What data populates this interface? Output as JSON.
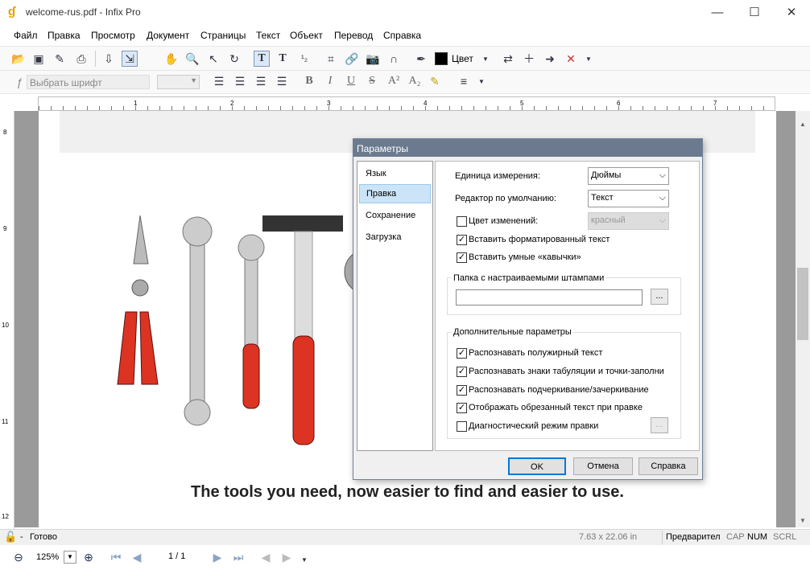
{
  "window": {
    "title": "welcome-rus.pdf - Infix Pro",
    "minimize": "—",
    "maximize": "☐",
    "close": "✕"
  },
  "menu": [
    "Файл",
    "Правка",
    "Просмотр",
    "Документ",
    "Страницы",
    "Текст",
    "Объект",
    "Перевод",
    "Справка"
  ],
  "toolbar": {
    "color_label": "Цвет",
    "font_placeholder": "Выбрать шрифт"
  },
  "ruler": {
    "h_marks": [
      "1",
      "2",
      "3",
      "4",
      "5",
      "6",
      "7"
    ],
    "v_marks": [
      "8",
      "9",
      "10",
      "11",
      "12"
    ]
  },
  "document": {
    "caption": "The tools you need, now easier to find and easier to use."
  },
  "dialog": {
    "title": "Параметры",
    "nav": [
      "Язык",
      "Правка",
      "Сохранение",
      "Загрузка"
    ],
    "selected_nav": "Правка",
    "units_label": "Единица измерения:",
    "units_value": "Дюймы",
    "editor_label": "Редактор по умолчанию:",
    "editor_value": "Текст",
    "color_changes_label": "Цвет изменений:",
    "color_changes_value": "красный",
    "color_changes_checked": false,
    "paste_formatted_label": "Вставить форматированный текст",
    "paste_formatted_checked": true,
    "smart_quotes_label": "Вставить умные «кавычки»",
    "smart_quotes_checked": true,
    "stamps_group": "Папка с настраиваемыми штампами",
    "stamps_path": "",
    "browse_label": "...",
    "advanced_group": "Дополнительные параметры",
    "advanced": [
      {
        "label": "Распознавать полужирный текст",
        "checked": true
      },
      {
        "label": "Распознавать знаки табуляции и точки-заполни",
        "checked": true
      },
      {
        "label": "Распознавать подчеркивание/зачеркивание",
        "checked": true
      },
      {
        "label": "Отображать обрезанный текст при правке",
        "checked": true
      },
      {
        "label": "Диагностический режим правки",
        "checked": false
      }
    ],
    "ok": "OK",
    "cancel": "Отмена",
    "help": "Справка"
  },
  "status": {
    "state": "Готово",
    "dash": "-",
    "coords": "7.63 x 22.06 in",
    "mode": "Предварител",
    "cap": "CAP",
    "num": "NUM",
    "scrl": "SCRL"
  },
  "nav": {
    "zoom": "125%",
    "page": "1 / 1"
  }
}
